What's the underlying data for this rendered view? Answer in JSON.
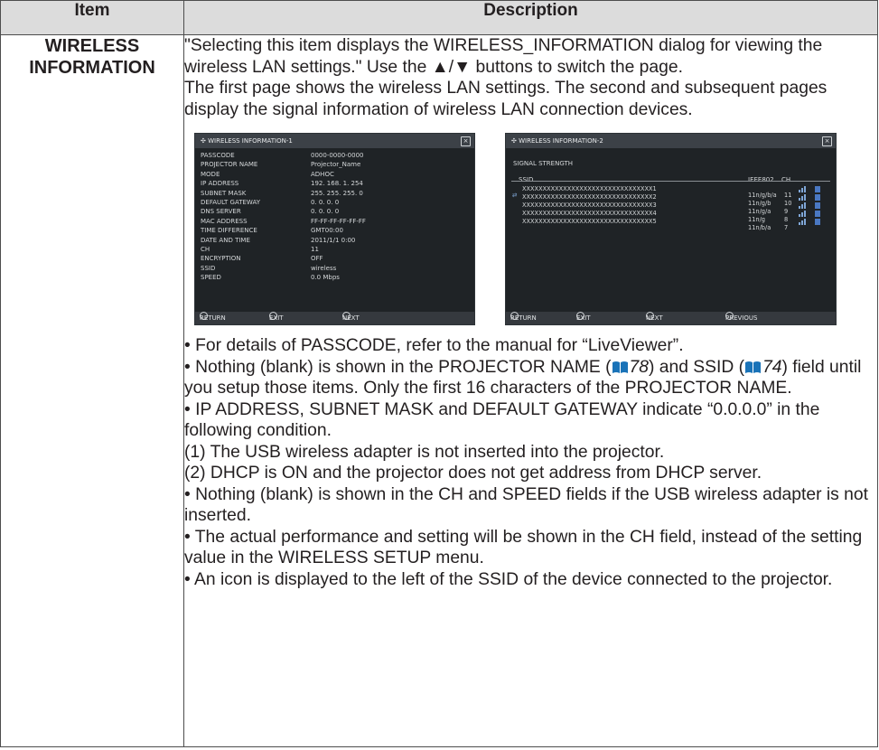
{
  "table": {
    "header_item": "Item",
    "header_description": "Description",
    "item_line1": "WIRELESS",
    "item_line2": "INFORMATION"
  },
  "intro": {
    "p1": "\"Selecting this item displays the WIRELESS_INFORMATION dialog for viewing the wireless LAN settings.\" Use the ▲/▼ buttons to switch the page.",
    "p2": "The first page shows the wireless LAN settings. The second and subsequent pages display the signal information of wireless LAN connection devices."
  },
  "dialog1": {
    "title": "WIRELESS INFORMATION-1",
    "rows": [
      {
        "k": "PASSCODE",
        "v": "0000-0000-0000"
      },
      {
        "k": "PROJECTOR NAME",
        "v": "Projector_Name"
      },
      {
        "k": "MODE",
        "v": "ADHOC"
      },
      {
        "k": "IP ADDRESS",
        "v": "192. 168. 1. 254"
      },
      {
        "k": "SUBNET MASK",
        "v": "255. 255. 255. 0"
      },
      {
        "k": "DEFAULT GATEWAY",
        "v": "0. 0. 0. 0"
      },
      {
        "k": "DNS SERVER",
        "v": "0. 0. 0. 0"
      },
      {
        "k": "MAC ADDRESS",
        "v": "FF-FF-FF-FF-FF-FF"
      },
      {
        "k": "TIME DIFFERENCE",
        "v": "GMT00:00"
      },
      {
        "k": "DATE AND TIME",
        "v": "2011/1/1  0:00"
      },
      {
        "k": "CH",
        "v": "11"
      },
      {
        "k": "ENCRYPTION",
        "v": "OFF"
      },
      {
        "k": "SSID",
        "v": "wireless"
      },
      {
        "k": "SPEED",
        "v": "0.0 Mbps"
      }
    ],
    "footer": {
      "return": "RETURN",
      "exit": "EXIT",
      "next": "NEXT"
    }
  },
  "dialog2": {
    "title": "WIRELESS INFORMATION-2",
    "label": "SIGNAL STRENGTH",
    "col_ssid": "SSID",
    "col_ieee": "IEEE802.",
    "col_ch": "CH",
    "devices": [
      {
        "ssid": "XXXXXXXXXXXXXXXXXXXXXXXXXXXXXXXX1",
        "ieee": "11n/g/b/a",
        "ch": "11"
      },
      {
        "ssid": "XXXXXXXXXXXXXXXXXXXXXXXXXXXXXXXX2",
        "ieee": "11n/g/b",
        "ch": "10"
      },
      {
        "ssid": "XXXXXXXXXXXXXXXXXXXXXXXXXXXXXXXX3",
        "ieee": "11n/g/a",
        "ch": "9"
      },
      {
        "ssid": "XXXXXXXXXXXXXXXXXXXXXXXXXXXXXXXX4",
        "ieee": "11n/g",
        "ch": "8"
      },
      {
        "ssid": "XXXXXXXXXXXXXXXXXXXXXXXXXXXXXXXX5",
        "ieee": "11n/b/a",
        "ch": "7"
      }
    ],
    "footer": {
      "return": "RETURN",
      "exit": "EXIT",
      "next": "NEXT",
      "previous": "PREVIOUS"
    }
  },
  "notes": {
    "passcode": "• For details of PASSCODE, refer to the manual for “LiveViewer”.",
    "blank_a": "• Nothing (blank) is shown in the PROJECTOR NAME (",
    "ref1": "78",
    "blank_b": ") and SSID (",
    "ref2": "74",
    "blank_c": ") field until you setup those items. Only the first 16 characters of the PROJECTOR NAME.",
    "ip": "• IP ADDRESS, SUBNET MASK and DEFAULT GATEWAY indicate “0.0.0.0” in the following condition.",
    "cond1": "(1) The USB wireless adapter is not inserted into the projector.",
    "cond2": "(2) DHCP is ON and the projector does not get address from DHCP server.",
    "ch_speed": "• Nothing (blank) is shown in the CH and SPEED fields if the USB wireless adapter is not inserted.",
    "actual": "• The actual performance and setting will be shown in the CH field, instead of the setting value in the WIRELESS SETUP menu.",
    "icon": "• An icon is displayed to the left of the SSID of the device connected to the projector."
  }
}
